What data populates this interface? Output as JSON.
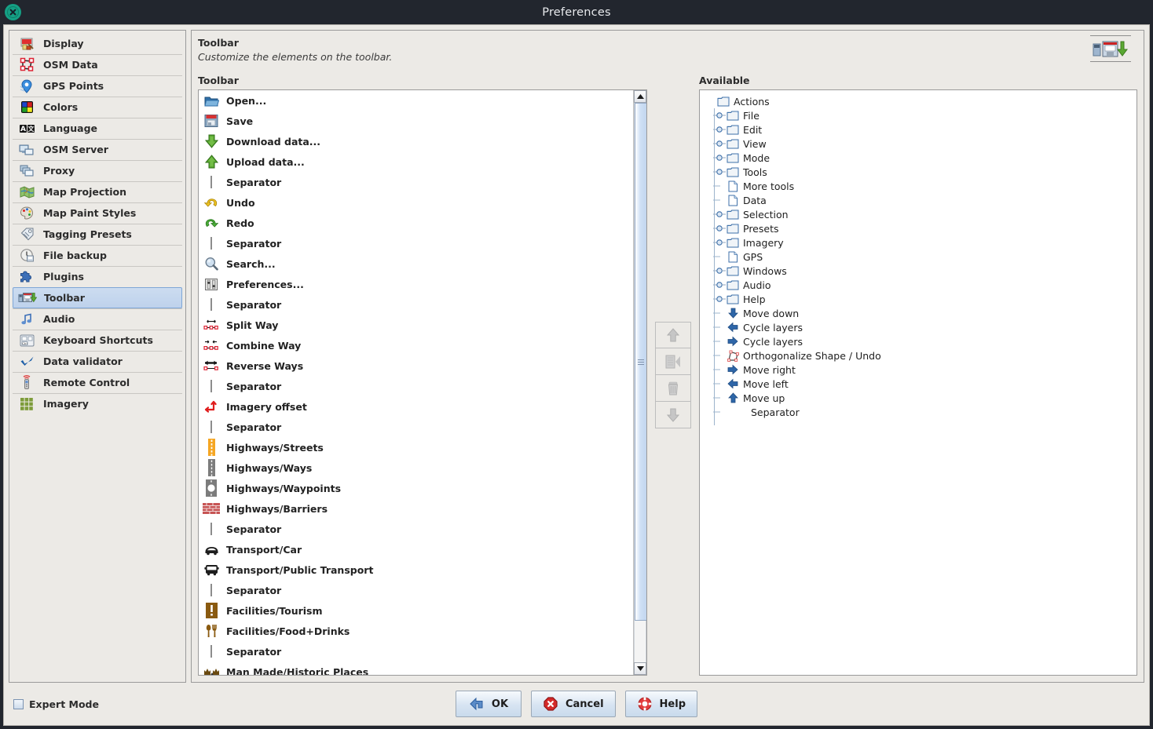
{
  "window": {
    "title": "Preferences",
    "close_icon": "close-circle-icon"
  },
  "sidebar": {
    "items": [
      {
        "label": "Display",
        "icon": "display-icon",
        "selected": false
      },
      {
        "label": "OSM Data",
        "icon": "osm-data-icon",
        "selected": false
      },
      {
        "label": "GPS Points",
        "icon": "gps-points-icon",
        "selected": false
      },
      {
        "label": "Colors",
        "icon": "colors-icon",
        "selected": false
      },
      {
        "label": "Language",
        "icon": "language-icon",
        "selected": false
      },
      {
        "label": "OSM Server",
        "icon": "osm-server-icon",
        "selected": false
      },
      {
        "label": "Proxy",
        "icon": "proxy-icon",
        "selected": false
      },
      {
        "label": "Map Projection",
        "icon": "map-projection-icon",
        "selected": false
      },
      {
        "label": "Map Paint Styles",
        "icon": "map-paint-styles-icon",
        "selected": false
      },
      {
        "label": "Tagging Presets",
        "icon": "tagging-presets-icon",
        "selected": false
      },
      {
        "label": "File backup",
        "icon": "file-backup-icon",
        "selected": false
      },
      {
        "label": "Plugins",
        "icon": "plugins-icon",
        "selected": false
      },
      {
        "label": "Toolbar",
        "icon": "toolbar-icon",
        "selected": true
      },
      {
        "label": "Audio",
        "icon": "audio-icon",
        "selected": false
      },
      {
        "label": "Keyboard Shortcuts",
        "icon": "keyboard-shortcuts-icon",
        "selected": false
      },
      {
        "label": "Data validator",
        "icon": "data-validator-icon",
        "selected": false
      },
      {
        "label": "Remote Control",
        "icon": "remote-control-icon",
        "selected": false
      },
      {
        "label": "Imagery",
        "icon": "imagery-icon",
        "selected": false
      }
    ]
  },
  "main": {
    "heading": "Toolbar",
    "subheading": "Customize the elements on the toolbar.",
    "header_icon": "toolbar-icon"
  },
  "toolbar_pane": {
    "title": "Toolbar",
    "items": [
      {
        "label": "Open...",
        "icon": "open-folder-icon"
      },
      {
        "label": "Save",
        "icon": "save-floppy-icon"
      },
      {
        "label": "Download data...",
        "icon": "download-arrow-icon"
      },
      {
        "label": "Upload data...",
        "icon": "upload-arrow-icon"
      },
      {
        "label": "Separator",
        "icon": "separator-icon"
      },
      {
        "label": "Undo",
        "icon": "undo-arrow-icon"
      },
      {
        "label": "Redo",
        "icon": "redo-arrow-icon"
      },
      {
        "label": "Separator",
        "icon": "separator-icon"
      },
      {
        "label": "Search...",
        "icon": "search-magnifier-icon"
      },
      {
        "label": "Preferences...",
        "icon": "preferences-sliders-icon"
      },
      {
        "label": "Separator",
        "icon": "separator-icon"
      },
      {
        "label": "Split Way",
        "icon": "split-way-icon"
      },
      {
        "label": "Combine Way",
        "icon": "combine-way-icon"
      },
      {
        "label": "Reverse Ways",
        "icon": "reverse-ways-icon"
      },
      {
        "label": "Separator",
        "icon": "separator-icon"
      },
      {
        "label": "Imagery offset",
        "icon": "imagery-offset-icon"
      },
      {
        "label": "Separator",
        "icon": "separator-icon"
      },
      {
        "label": "Highways/Streets",
        "icon": "highway-street-icon"
      },
      {
        "label": "Highways/Ways",
        "icon": "highway-way-icon"
      },
      {
        "label": "Highways/Waypoints",
        "icon": "highway-waypoint-icon"
      },
      {
        "label": "Highways/Barriers",
        "icon": "highway-barrier-icon"
      },
      {
        "label": "Separator",
        "icon": "separator-icon"
      },
      {
        "label": "Transport/Car",
        "icon": "transport-car-icon"
      },
      {
        "label": "Transport/Public Transport",
        "icon": "transport-bus-icon"
      },
      {
        "label": "Separator",
        "icon": "separator-icon"
      },
      {
        "label": "Facilities/Tourism",
        "icon": "tourism-icon"
      },
      {
        "label": "Facilities/Food+Drinks",
        "icon": "food-drinks-icon"
      },
      {
        "label": "Separator",
        "icon": "separator-icon"
      },
      {
        "label": "Man Made/Historic Places",
        "icon": "man-made-historic-icon"
      }
    ]
  },
  "transfer_buttons": [
    {
      "name": "move-up-button",
      "icon": "up-arrow-icon"
    },
    {
      "name": "add-button",
      "icon": "add-left-arrow-icon"
    },
    {
      "name": "remove-button",
      "icon": "trash-icon"
    },
    {
      "name": "move-down-button",
      "icon": "down-arrow-icon"
    }
  ],
  "available_pane": {
    "title": "Available",
    "nodes": [
      {
        "label": "Actions",
        "icon": "folder-icon",
        "depth": 0,
        "handle": "none"
      },
      {
        "label": "File",
        "icon": "folder-icon",
        "depth": 1,
        "handle": "collapsed"
      },
      {
        "label": "Edit",
        "icon": "folder-icon",
        "depth": 1,
        "handle": "collapsed"
      },
      {
        "label": "View",
        "icon": "folder-icon",
        "depth": 1,
        "handle": "collapsed"
      },
      {
        "label": "Mode",
        "icon": "folder-icon",
        "depth": 1,
        "handle": "collapsed"
      },
      {
        "label": "Tools",
        "icon": "folder-icon",
        "depth": 1,
        "handle": "collapsed"
      },
      {
        "label": "More tools",
        "icon": "file-icon",
        "depth": 1,
        "handle": "leaf"
      },
      {
        "label": "Data",
        "icon": "file-icon",
        "depth": 1,
        "handle": "leaf"
      },
      {
        "label": "Selection",
        "icon": "folder-icon",
        "depth": 1,
        "handle": "collapsed"
      },
      {
        "label": "Presets",
        "icon": "folder-icon",
        "depth": 1,
        "handle": "collapsed"
      },
      {
        "label": "Imagery",
        "icon": "folder-icon",
        "depth": 1,
        "handle": "collapsed"
      },
      {
        "label": "GPS",
        "icon": "file-icon",
        "depth": 1,
        "handle": "leaf"
      },
      {
        "label": "Windows",
        "icon": "folder-icon",
        "depth": 1,
        "handle": "collapsed"
      },
      {
        "label": "Audio",
        "icon": "folder-icon",
        "depth": 1,
        "handle": "collapsed"
      },
      {
        "label": "Help",
        "icon": "folder-icon",
        "depth": 1,
        "handle": "collapsed"
      },
      {
        "label": "Move down",
        "icon": "down-arrow-icon",
        "depth": 1,
        "handle": "leaf"
      },
      {
        "label": "Cycle layers",
        "icon": "left-arrow-icon",
        "depth": 1,
        "handle": "leaf"
      },
      {
        "label": "Cycle layers",
        "icon": "right-arrow-icon",
        "depth": 1,
        "handle": "leaf"
      },
      {
        "label": "Orthogonalize Shape / Undo",
        "icon": "orthogonalize-icon",
        "depth": 1,
        "handle": "leaf"
      },
      {
        "label": "Move right",
        "icon": "right-arrow-icon",
        "depth": 1,
        "handle": "leaf"
      },
      {
        "label": "Move left",
        "icon": "left-arrow-icon",
        "depth": 1,
        "handle": "leaf"
      },
      {
        "label": "Move up",
        "icon": "up-arrow-icon",
        "depth": 1,
        "handle": "leaf"
      },
      {
        "label": "Separator",
        "icon": "separator-icon",
        "depth": 1,
        "handle": "leaf"
      }
    ]
  },
  "bottom": {
    "expert_mode_label": "Expert Mode",
    "expert_mode_checked": false,
    "buttons": [
      {
        "label": "OK",
        "icon": "ok-arrow-icon",
        "name": "ok-button"
      },
      {
        "label": "Cancel",
        "icon": "cancel-icon",
        "name": "cancel-button"
      },
      {
        "label": "Help",
        "icon": "help-lifering-icon",
        "name": "help-button"
      }
    ]
  },
  "colors": {
    "titlebar_bg": "#22262e",
    "dialog_bg": "#eceae6",
    "selection_bg": "#c6d8ef",
    "accent_green": "#15a085",
    "list_bg": "#ffffff"
  }
}
